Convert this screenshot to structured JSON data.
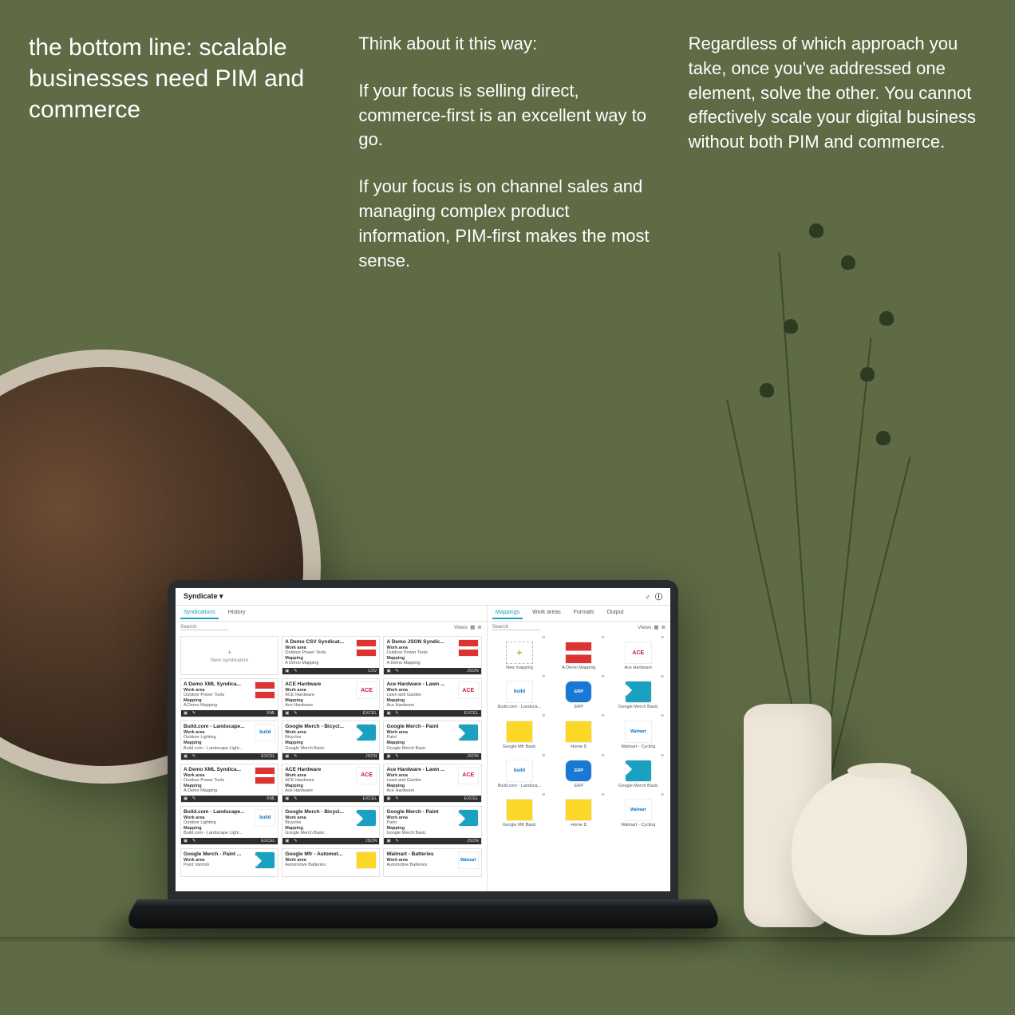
{
  "heading": "the bottom line: scalable businesses need PIM and commerce",
  "col2": {
    "lead": "Think about it this way:",
    "p1": "If your focus is selling direct, commerce-first is an excellent way to go.",
    "p2": "If your focus is on channel sales and managing complex product information, PIM-first makes the most sense."
  },
  "col3": {
    "p1": "Regardless of which approach you take, once you've addressed one element, solve the other. You cannot effectively scale your digital business without both PIM and commerce."
  },
  "app": {
    "title": "Syndicate",
    "left_tabs": [
      "Syndications",
      "History"
    ],
    "right_tabs": [
      "Mappings",
      "Work areas",
      "Formats",
      "Output"
    ],
    "search_label": "Search",
    "views_label": "Views",
    "new_card": "New syndication",
    "new_tile": "New mapping",
    "cards": [
      {
        "title": "A Demo CSV Syndicat...",
        "work": "Outdoor Power Tools",
        "map": "A Demo Mapping",
        "fmt": "CSV",
        "thumb": "awning"
      },
      {
        "title": "A Demo JSON Syndic...",
        "work": "Outdoor Power Tools",
        "map": "A Demo Mapping",
        "fmt": "JSON",
        "thumb": "awning"
      },
      {
        "title": "A Demo XML Syndica...",
        "work": "Outdoor Power Tools",
        "map": "A Demo Mapping",
        "fmt": "XML",
        "thumb": "awning"
      },
      {
        "title": "ACE Hardware",
        "work": "ACE Hardware",
        "map": "Ace Hardware",
        "fmt": "EXCEL",
        "thumb": "ace"
      },
      {
        "title": "Ace Hardware - Lawn ...",
        "work": "Lawn and Garden",
        "map": "Ace Hardware",
        "fmt": "EXCEL",
        "thumb": "ace"
      },
      {
        "title": "Build.com - Landscape...",
        "work": "Outdoor Lighting",
        "map": "Build.com - Landscape Light...",
        "fmt": "EXCEL",
        "thumb": "build"
      },
      {
        "title": "Google Merch - Bicycl...",
        "work": "Bicycles",
        "map": "Google Merch Basic",
        "fmt": "JSON",
        "thumb": "tag"
      },
      {
        "title": "Google Merch - Paint",
        "work": "Paint",
        "map": "Google Merch Basic",
        "fmt": "JSON",
        "thumb": "tag"
      },
      {
        "title": "A Demo XML Syndica...",
        "work": "Outdoor Power Tools",
        "map": "A Demo Mapping",
        "fmt": "XML",
        "thumb": "awning"
      },
      {
        "title": "ACE Hardware",
        "work": "ACE Hardware",
        "map": "Ace Hardware",
        "fmt": "EXCEL",
        "thumb": "ace"
      },
      {
        "title": "Ace Hardware - Lawn ...",
        "work": "Lawn and Garden",
        "map": "Ace Hardware",
        "fmt": "EXCEL",
        "thumb": "ace"
      },
      {
        "title": "Build.com - Landscape...",
        "work": "Outdoor Lighting",
        "map": "Build.com - Landscape Light...",
        "fmt": "EXCEL",
        "thumb": "build"
      },
      {
        "title": "Google Merch - Bicycl...",
        "work": "Bicycles",
        "map": "Google Merch Basic",
        "fmt": "JSON",
        "thumb": "tag"
      },
      {
        "title": "Google Merch - Paint",
        "work": "Paint",
        "map": "Google Merch Basic",
        "fmt": "JSON",
        "thumb": "tag"
      },
      {
        "title": "Google Merch - Paint ...",
        "work": "Paint Varnish",
        "map": "",
        "fmt": "",
        "thumb": "tag"
      },
      {
        "title": "Google Mfr - Automot...",
        "work": "Automotive Batteries",
        "map": "",
        "fmt": "",
        "thumb": "gift"
      },
      {
        "title": "Walmart - Batteries",
        "work": "Automotive Batteries",
        "map": "",
        "fmt": "",
        "thumb": "walmart"
      }
    ],
    "tiles": [
      {
        "label": "A Demo Mapping",
        "thumb": "awning"
      },
      {
        "label": "Ace Hardware",
        "thumb": "ace"
      },
      {
        "label": "Build.com - Landsca...",
        "thumb": "build"
      },
      {
        "label": "ERP",
        "thumb": "erp"
      },
      {
        "label": "Google Merch Basic",
        "thumb": "tag"
      },
      {
        "label": "Google Mfr Basic",
        "thumb": "gift"
      },
      {
        "label": "Home D",
        "thumb": "gift"
      },
      {
        "label": "Walmart - Cycling",
        "thumb": "walmart"
      },
      {
        "label": "Build.com - Landsca...",
        "thumb": "build"
      },
      {
        "label": "ERP",
        "thumb": "erp"
      },
      {
        "label": "Google Merch Basic",
        "thumb": "tag"
      },
      {
        "label": "Google Mfr Basic",
        "thumb": "gift"
      },
      {
        "label": "Home D",
        "thumb": "gift"
      },
      {
        "label": "Walmart - Cycling",
        "thumb": "walmart"
      }
    ]
  }
}
